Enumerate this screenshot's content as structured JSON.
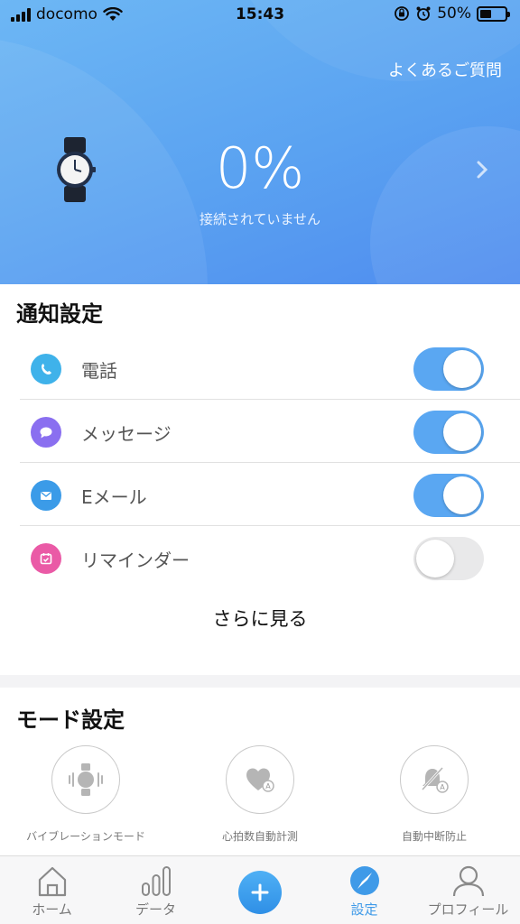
{
  "status_bar": {
    "carrier": "docomo",
    "time": "15:43",
    "battery": "50%"
  },
  "header": {
    "faq_label": "よくあるご質問",
    "battery_percent": "0%",
    "connection_status": "接続されていません"
  },
  "notifications": {
    "title": "通知設定",
    "items": [
      {
        "label": "電話",
        "enabled": true,
        "icon": "phone-icon",
        "color": "#3fb2ea"
      },
      {
        "label": "メッセージ",
        "enabled": true,
        "icon": "message-icon",
        "color": "#8a6ff0"
      },
      {
        "label": "Eメール",
        "enabled": true,
        "icon": "mail-icon",
        "color": "#3b9be8"
      },
      {
        "label": "リマインダー",
        "enabled": false,
        "icon": "reminder-icon",
        "color": "#ea5aa6"
      }
    ],
    "see_more": "さらに見る"
  },
  "modes": {
    "title": "モード設定",
    "items": [
      {
        "label": "バイブレーションモード",
        "icon": "vibration-watch-icon"
      },
      {
        "label": "心拍数自動計測",
        "icon": "heart-auto-icon"
      },
      {
        "label": "自動中断防止",
        "icon": "do-not-disturb-auto-icon"
      }
    ]
  },
  "tabbar": {
    "items": [
      {
        "label": "ホーム",
        "icon": "home-icon",
        "active": false
      },
      {
        "label": "データ",
        "icon": "bar-chart-icon",
        "active": false
      },
      {
        "label": "",
        "icon": "plus-icon",
        "active": false
      },
      {
        "label": "設定",
        "icon": "compass-icon",
        "active": true
      },
      {
        "label": "プロフィール",
        "icon": "profile-icon",
        "active": false
      }
    ]
  },
  "colors": {
    "accent": "#3f9ae8",
    "header_start": "#6db7f4",
    "header_end": "#4f8cef"
  }
}
